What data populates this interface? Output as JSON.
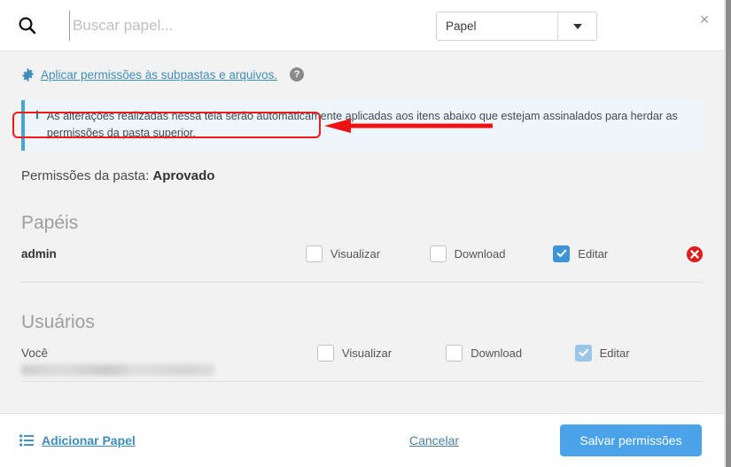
{
  "header": {
    "search_icon": "search-icon",
    "search_placeholder": "Buscar papel...",
    "search_value": "",
    "type_select_value": "Papel",
    "type_select_options": [
      "Papel"
    ],
    "close_label": "×"
  },
  "apply": {
    "gear_icon": "gear-icon",
    "link_label": "Aplicar permissões às subpastas e arquivos.",
    "help_icon": "help-circle-icon",
    "help_label": "?",
    "annotation_color": "#ef1b1b"
  },
  "alert": {
    "icon": "info-icon",
    "icon_label": "i",
    "text": "As alterações realizadas nessa tela serão automaticamente aplicadas aos itens abaixo que estejam assinalados para herdar as permissões da pasta superior.",
    "accent_color": "#4ba3d3",
    "background_color": "#eef6fb"
  },
  "folder": {
    "label": "Permissões da pasta:",
    "name": "Aprovado"
  },
  "sections": [
    {
      "title": "Papéis",
      "rows": [
        {
          "name": "admin",
          "name_bold": true,
          "blurred_secondary": false,
          "permissions": [
            {
              "label": "Visualizar",
              "checked": false,
              "disabled": false
            },
            {
              "label": "Download",
              "checked": false,
              "disabled": false
            },
            {
              "label": "Editar",
              "checked": true,
              "disabled": false
            }
          ],
          "delete_icon": "delete-circle-icon",
          "has_delete": true
        }
      ]
    },
    {
      "title": "Usuários",
      "rows": [
        {
          "name": "Você",
          "name_bold": false,
          "blurred_secondary": true,
          "permissions": [
            {
              "label": "Visualizar",
              "checked": false,
              "disabled": false
            },
            {
              "label": "Download",
              "checked": false,
              "disabled": false
            },
            {
              "label": "Editar",
              "checked": true,
              "disabled": true
            }
          ],
          "delete_icon": "",
          "has_delete": false
        }
      ]
    }
  ],
  "footer": {
    "add_role_icon": "list-icon",
    "add_role_label": "Adicionar Papel",
    "cancel_label": "Cancelar",
    "save_label": "Salvar permissões",
    "save_color": "#4aa3e8"
  }
}
